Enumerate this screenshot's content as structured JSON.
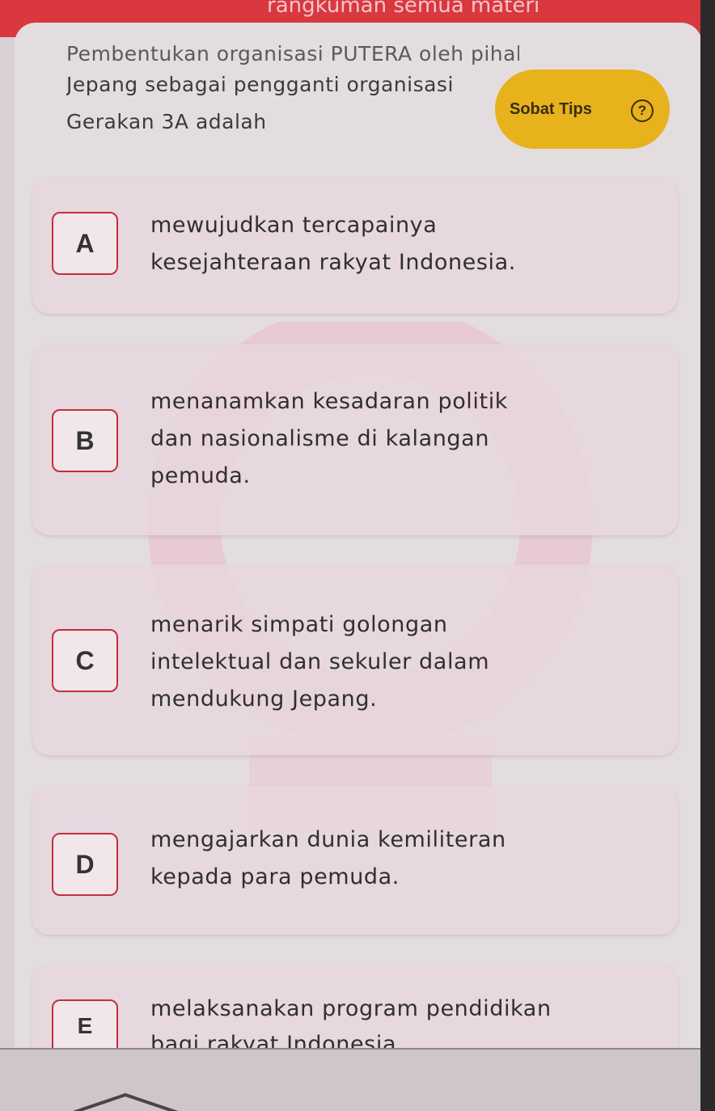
{
  "header": {
    "banner_text": "rangkuman semua materi"
  },
  "question": {
    "lines": [
      "Pembentukan organisasi PUTERA oleh pihak",
      "Jepang sebagai pengganti organisasi",
      "Gerakan 3A adalah"
    ]
  },
  "tips": {
    "label": "Sobat Tips",
    "icon_symbol": "?",
    "icon_name": "help-circle-icon"
  },
  "options": [
    {
      "letter": "A",
      "lines": [
        "mewujudkan tercapainya",
        "kesejahteraan rakyat Indonesia."
      ]
    },
    {
      "letter": "B",
      "lines": [
        "menanamkan kesadaran politik",
        "dan nasionalisme di kalangan",
        "pemuda."
      ]
    },
    {
      "letter": "C",
      "lines": [
        "menarik simpati golongan",
        "intelektual dan sekuler dalam",
        "mendukung Jepang."
      ]
    },
    {
      "letter": "D",
      "lines": [
        "mengajarkan dunia kemiliteran",
        "kepada para pemuda."
      ]
    },
    {
      "letter": "E",
      "lines": [
        "melaksanakan program pendidikan",
        "bagi rakyat Indonesia."
      ]
    }
  ],
  "colors": {
    "accent_red": "#c1303a",
    "tips_yellow": "#e7b21c",
    "top_bar_red": "#d9383f"
  }
}
